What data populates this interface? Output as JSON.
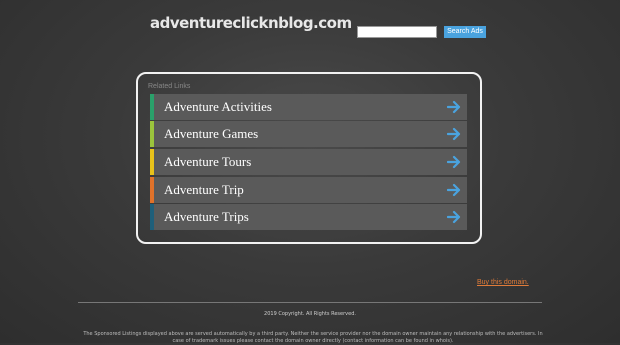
{
  "header": {
    "site_title": "adventureclicknblog.com",
    "search_placeholder": "",
    "search_button": "Search Ads"
  },
  "related": {
    "label": "Related Links",
    "items": [
      {
        "label": "Adventure Activities",
        "color": "#2aa06a",
        "icon": "arrow-right-icon"
      },
      {
        "label": "Adventure Games",
        "color": "#9bc43c",
        "icon": "arrow-right-icon"
      },
      {
        "label": "Adventure Tours",
        "color": "#e8c21a",
        "icon": "arrow-right-icon"
      },
      {
        "label": "Adventure Trip",
        "color": "#e0722a",
        "icon": "arrow-right-icon"
      },
      {
        "label": "Adventure Trips",
        "color": "#1f5f7a",
        "icon": "arrow-right-icon"
      }
    ],
    "arrow_color": "#4aa3df"
  },
  "buy_link": "Buy this domain.",
  "footer": {
    "copyright": "2019 Copyright. All Rights Reserved.",
    "disclaimer": "The Sponsored Listings displayed above are served automatically by a third party. Neither the service provider nor the domain owner maintain any relationship with the advertisers. In case of trademark issues please contact the domain owner directly (contact information can be found in whois)."
  }
}
